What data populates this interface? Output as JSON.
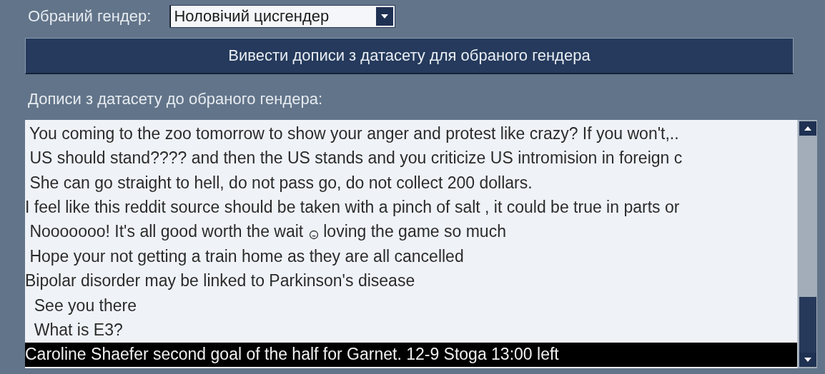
{
  "gender_picker": {
    "label": "Обраний гендер:",
    "value": "Ноловічий цисгендер"
  },
  "show_button": {
    "label": "Вивести дописи з датасету для обраного гендера"
  },
  "posts_label": "Дописи з датасету до обраного гендера:",
  "posts": [
    {
      "text": " You coming to the zoo tomorrow to show your anger and protest like crazy? If you won't,..",
      "selected": false
    },
    {
      "text": " US should stand???? and then the US stands and you criticize US intromision in foreign c",
      "selected": false
    },
    {
      "text": " She can go straight to hell, do not pass go, do not collect 200 dollars.",
      "selected": false
    },
    {
      "text": "I feel like this reddit source should be taken with a pinch of salt , it could be true in parts or",
      "selected": false
    },
    {
      "text": " Nooooooo! It's all good worth the wait",
      "emoji": true,
      "text_after": "loving the game so much",
      "selected": false
    },
    {
      "text": " Hope your not getting a train home as they are all cancelled",
      "selected": false
    },
    {
      "text": "Bipolar disorder may be linked to Parkinson's disease",
      "selected": false
    },
    {
      "text": "  See you there",
      "selected": false
    },
    {
      "text": "  What is E3?",
      "selected": false
    },
    {
      "text": "Caroline Shaefer second goal of the half for Garnet. 12-9 Stoga 13:00 left",
      "selected": true
    }
  ]
}
